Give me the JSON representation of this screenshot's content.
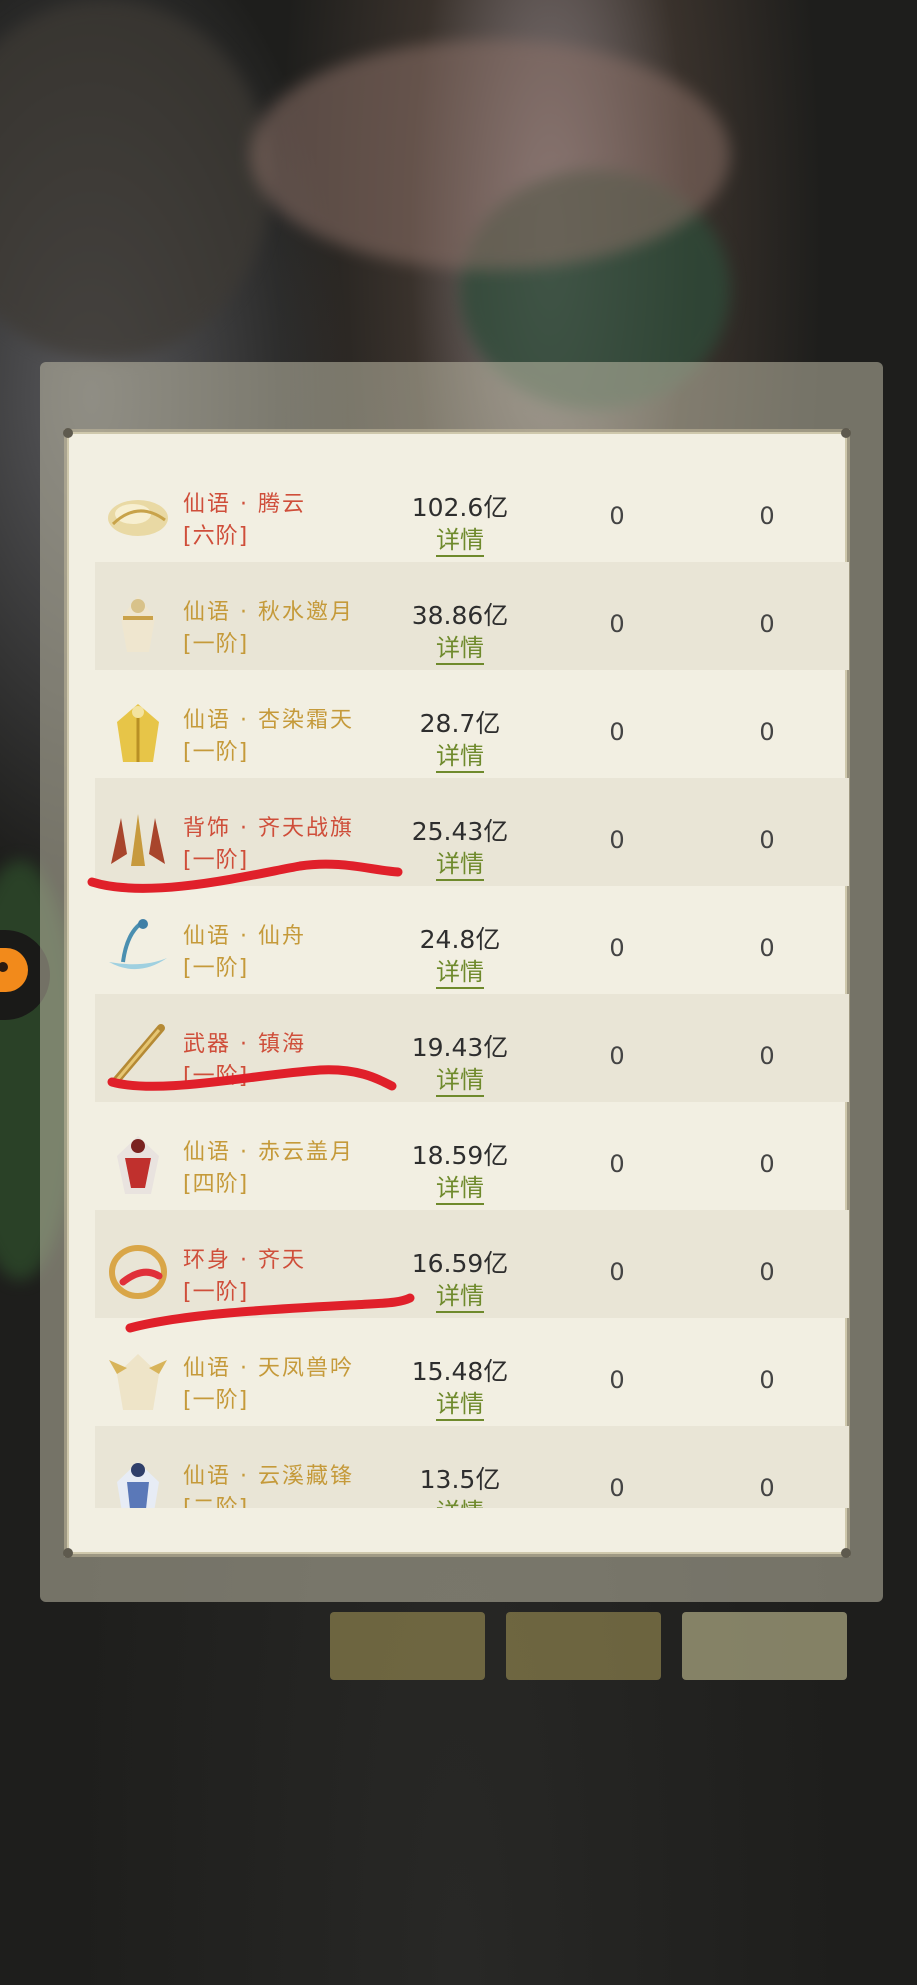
{
  "list": {
    "rows": [
      {
        "name": "仙语 · 腾云",
        "tier": "[六阶]",
        "value": "102.6亿",
        "detail": "详情",
        "c1": "0",
        "c2": "0",
        "icon": "gold-cloud-icon",
        "red": true
      },
      {
        "name": "仙语 · 秋水邀月",
        "tier": "[一阶]",
        "value": "38.86亿",
        "detail": "详情",
        "c1": "0",
        "c2": "0",
        "icon": "white-gold-outfit-icon",
        "red": false
      },
      {
        "name": "仙语 · 杏染霜天",
        "tier": "[一阶]",
        "value": "28.7亿",
        "detail": "详情",
        "c1": "0",
        "c2": "0",
        "icon": "yellow-robe-icon",
        "red": false
      },
      {
        "name": "背饰 · 齐天战旗",
        "tier": "[一阶]",
        "value": "25.43亿",
        "detail": "详情",
        "c1": "0",
        "c2": "0",
        "icon": "war-banner-icon",
        "red": true
      },
      {
        "name": "仙语 · 仙舟",
        "tier": "[一阶]",
        "value": "24.8亿",
        "detail": "详情",
        "c1": "0",
        "c2": "0",
        "icon": "blue-boat-icon",
        "red": false
      },
      {
        "name": "武器 · 镇海",
        "tier": "[一阶]",
        "value": "19.43亿",
        "detail": "详情",
        "c1": "0",
        "c2": "0",
        "icon": "golden-staff-icon",
        "red": true
      },
      {
        "name": "仙语 · 赤云盖月",
        "tier": "[四阶]",
        "value": "18.59亿",
        "detail": "详情",
        "c1": "0",
        "c2": "0",
        "icon": "red-white-outfit-icon",
        "red": false
      },
      {
        "name": "环身 · 齐天",
        "tier": "[一阶]",
        "value": "16.59亿",
        "detail": "详情",
        "c1": "0",
        "c2": "0",
        "icon": "red-ring-icon",
        "red": true
      },
      {
        "name": "仙语 · 天凤兽吟",
        "tier": "[一阶]",
        "value": "15.48亿",
        "detail": "详情",
        "c1": "0",
        "c2": "0",
        "icon": "phoenix-outfit-icon",
        "red": false
      },
      {
        "name": "仙语 · 云溪藏锋",
        "tier": "[二阶]",
        "value": "13.5亿",
        "detail": "详情",
        "c1": "0",
        "c2": "0",
        "icon": "blue-white-outfit-icon",
        "red": false
      }
    ]
  },
  "colors": {
    "name_gold": "#c59a3a",
    "name_red": "#cf4e3a",
    "detail_green": "#6f8a2c",
    "annotation_red": "#e0202a"
  }
}
